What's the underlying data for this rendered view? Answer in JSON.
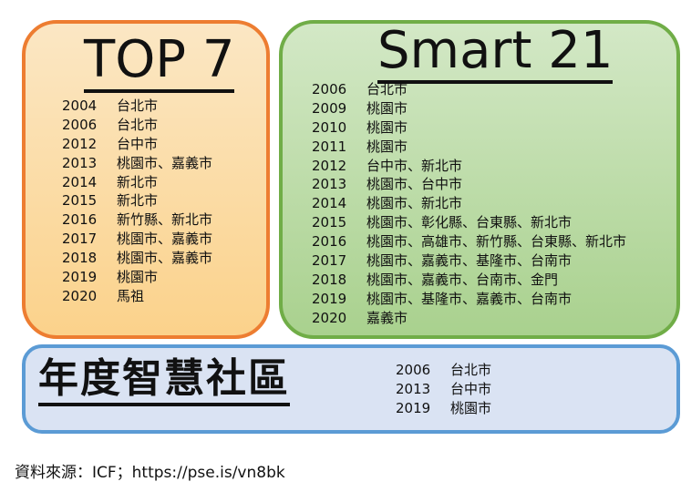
{
  "top7": {
    "title": "TOP 7",
    "entries": [
      {
        "year": "2004",
        "places": "台北市"
      },
      {
        "year": "2006",
        "places": "台北市"
      },
      {
        "year": "2012",
        "places": "台中市"
      },
      {
        "year": "2013",
        "places": "桃園市、嘉義市"
      },
      {
        "year": "2014",
        "places": "新北市"
      },
      {
        "year": "2015",
        "places": "新北市"
      },
      {
        "year": "2016",
        "places": "新竹縣、新北市"
      },
      {
        "year": "2017",
        "places": "桃園市、嘉義市"
      },
      {
        "year": "2018",
        "places": "桃園市、嘉義市"
      },
      {
        "year": "2019",
        "places": "桃園市"
      },
      {
        "year": "2020",
        "places": "馬祖"
      }
    ]
  },
  "smart21": {
    "title": "Smart 21",
    "entries": [
      {
        "year": "2006",
        "places": "台北市"
      },
      {
        "year": "2009",
        "places": "桃園市"
      },
      {
        "year": "2010",
        "places": "桃園市"
      },
      {
        "year": "2011",
        "places": "桃園市"
      },
      {
        "year": "2012",
        "places": "台中市、新北市"
      },
      {
        "year": "2013",
        "places": "桃園市、台中市"
      },
      {
        "year": "2014",
        "places": "桃園市、新北市"
      },
      {
        "year": "2015",
        "places": "桃園市、彰化縣、台東縣、新北市"
      },
      {
        "year": "2016",
        "places": "桃園市、高雄市、新竹縣、台東縣、新北市"
      },
      {
        "year": "2017",
        "places": "桃園市、嘉義市、基隆市、台南市"
      },
      {
        "year": "2018",
        "places": "桃園市、嘉義市、台南市、金門"
      },
      {
        "year": "2019",
        "places": "桃園市、基隆市、嘉義市、台南市"
      },
      {
        "year": "2020",
        "places": "嘉義市"
      }
    ]
  },
  "community": {
    "title": "年度智慧社區",
    "entries": [
      {
        "year": "2006",
        "places": "台北市"
      },
      {
        "year": "2013",
        "places": "台中市"
      },
      {
        "year": "2019",
        "places": "桃園市"
      }
    ]
  },
  "source": "資料來源：ICF；https://pse.is/vn8bk",
  "colors": {
    "top7_border": "#ed7d31",
    "top7_fill": "#fbd28b",
    "smart21_border": "#70ad47",
    "smart21_fill": "#a9d18e",
    "community_border": "#5b9bd5",
    "community_fill": "#dae3f3"
  }
}
